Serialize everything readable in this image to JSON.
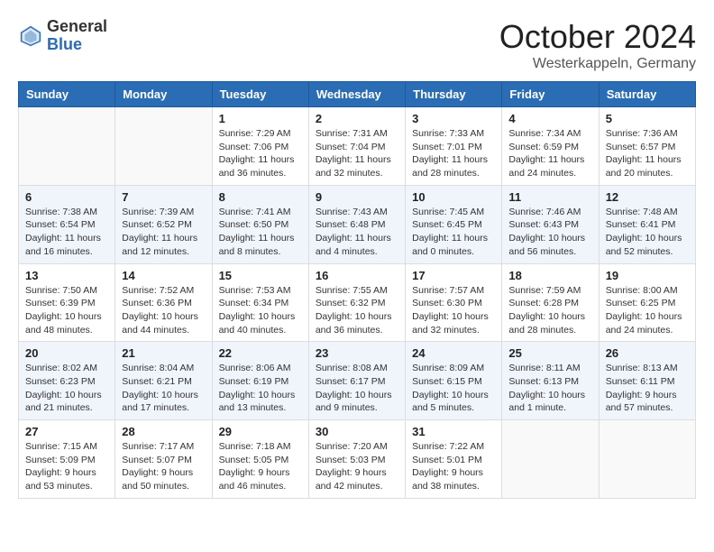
{
  "header": {
    "logo_general": "General",
    "logo_blue": "Blue",
    "month_title": "October 2024",
    "location": "Westerkappeln, Germany"
  },
  "weekdays": [
    "Sunday",
    "Monday",
    "Tuesday",
    "Wednesday",
    "Thursday",
    "Friday",
    "Saturday"
  ],
  "weeks": [
    [
      {
        "day": "",
        "info": ""
      },
      {
        "day": "",
        "info": ""
      },
      {
        "day": "1",
        "info": "Sunrise: 7:29 AM\nSunset: 7:06 PM\nDaylight: 11 hours\nand 36 minutes."
      },
      {
        "day": "2",
        "info": "Sunrise: 7:31 AM\nSunset: 7:04 PM\nDaylight: 11 hours\nand 32 minutes."
      },
      {
        "day": "3",
        "info": "Sunrise: 7:33 AM\nSunset: 7:01 PM\nDaylight: 11 hours\nand 28 minutes."
      },
      {
        "day": "4",
        "info": "Sunrise: 7:34 AM\nSunset: 6:59 PM\nDaylight: 11 hours\nand 24 minutes."
      },
      {
        "day": "5",
        "info": "Sunrise: 7:36 AM\nSunset: 6:57 PM\nDaylight: 11 hours\nand 20 minutes."
      }
    ],
    [
      {
        "day": "6",
        "info": "Sunrise: 7:38 AM\nSunset: 6:54 PM\nDaylight: 11 hours\nand 16 minutes."
      },
      {
        "day": "7",
        "info": "Sunrise: 7:39 AM\nSunset: 6:52 PM\nDaylight: 11 hours\nand 12 minutes."
      },
      {
        "day": "8",
        "info": "Sunrise: 7:41 AM\nSunset: 6:50 PM\nDaylight: 11 hours\nand 8 minutes."
      },
      {
        "day": "9",
        "info": "Sunrise: 7:43 AM\nSunset: 6:48 PM\nDaylight: 11 hours\nand 4 minutes."
      },
      {
        "day": "10",
        "info": "Sunrise: 7:45 AM\nSunset: 6:45 PM\nDaylight: 11 hours\nand 0 minutes."
      },
      {
        "day": "11",
        "info": "Sunrise: 7:46 AM\nSunset: 6:43 PM\nDaylight: 10 hours\nand 56 minutes."
      },
      {
        "day": "12",
        "info": "Sunrise: 7:48 AM\nSunset: 6:41 PM\nDaylight: 10 hours\nand 52 minutes."
      }
    ],
    [
      {
        "day": "13",
        "info": "Sunrise: 7:50 AM\nSunset: 6:39 PM\nDaylight: 10 hours\nand 48 minutes."
      },
      {
        "day": "14",
        "info": "Sunrise: 7:52 AM\nSunset: 6:36 PM\nDaylight: 10 hours\nand 44 minutes."
      },
      {
        "day": "15",
        "info": "Sunrise: 7:53 AM\nSunset: 6:34 PM\nDaylight: 10 hours\nand 40 minutes."
      },
      {
        "day": "16",
        "info": "Sunrise: 7:55 AM\nSunset: 6:32 PM\nDaylight: 10 hours\nand 36 minutes."
      },
      {
        "day": "17",
        "info": "Sunrise: 7:57 AM\nSunset: 6:30 PM\nDaylight: 10 hours\nand 32 minutes."
      },
      {
        "day": "18",
        "info": "Sunrise: 7:59 AM\nSunset: 6:28 PM\nDaylight: 10 hours\nand 28 minutes."
      },
      {
        "day": "19",
        "info": "Sunrise: 8:00 AM\nSunset: 6:25 PM\nDaylight: 10 hours\nand 24 minutes."
      }
    ],
    [
      {
        "day": "20",
        "info": "Sunrise: 8:02 AM\nSunset: 6:23 PM\nDaylight: 10 hours\nand 21 minutes."
      },
      {
        "day": "21",
        "info": "Sunrise: 8:04 AM\nSunset: 6:21 PM\nDaylight: 10 hours\nand 17 minutes."
      },
      {
        "day": "22",
        "info": "Sunrise: 8:06 AM\nSunset: 6:19 PM\nDaylight: 10 hours\nand 13 minutes."
      },
      {
        "day": "23",
        "info": "Sunrise: 8:08 AM\nSunset: 6:17 PM\nDaylight: 10 hours\nand 9 minutes."
      },
      {
        "day": "24",
        "info": "Sunrise: 8:09 AM\nSunset: 6:15 PM\nDaylight: 10 hours\nand 5 minutes."
      },
      {
        "day": "25",
        "info": "Sunrise: 8:11 AM\nSunset: 6:13 PM\nDaylight: 10 hours\nand 1 minute."
      },
      {
        "day": "26",
        "info": "Sunrise: 8:13 AM\nSunset: 6:11 PM\nDaylight: 9 hours\nand 57 minutes."
      }
    ],
    [
      {
        "day": "27",
        "info": "Sunrise: 7:15 AM\nSunset: 5:09 PM\nDaylight: 9 hours\nand 53 minutes."
      },
      {
        "day": "28",
        "info": "Sunrise: 7:17 AM\nSunset: 5:07 PM\nDaylight: 9 hours\nand 50 minutes."
      },
      {
        "day": "29",
        "info": "Sunrise: 7:18 AM\nSunset: 5:05 PM\nDaylight: 9 hours\nand 46 minutes."
      },
      {
        "day": "30",
        "info": "Sunrise: 7:20 AM\nSunset: 5:03 PM\nDaylight: 9 hours\nand 42 minutes."
      },
      {
        "day": "31",
        "info": "Sunrise: 7:22 AM\nSunset: 5:01 PM\nDaylight: 9 hours\nand 38 minutes."
      },
      {
        "day": "",
        "info": ""
      },
      {
        "day": "",
        "info": ""
      }
    ]
  ]
}
